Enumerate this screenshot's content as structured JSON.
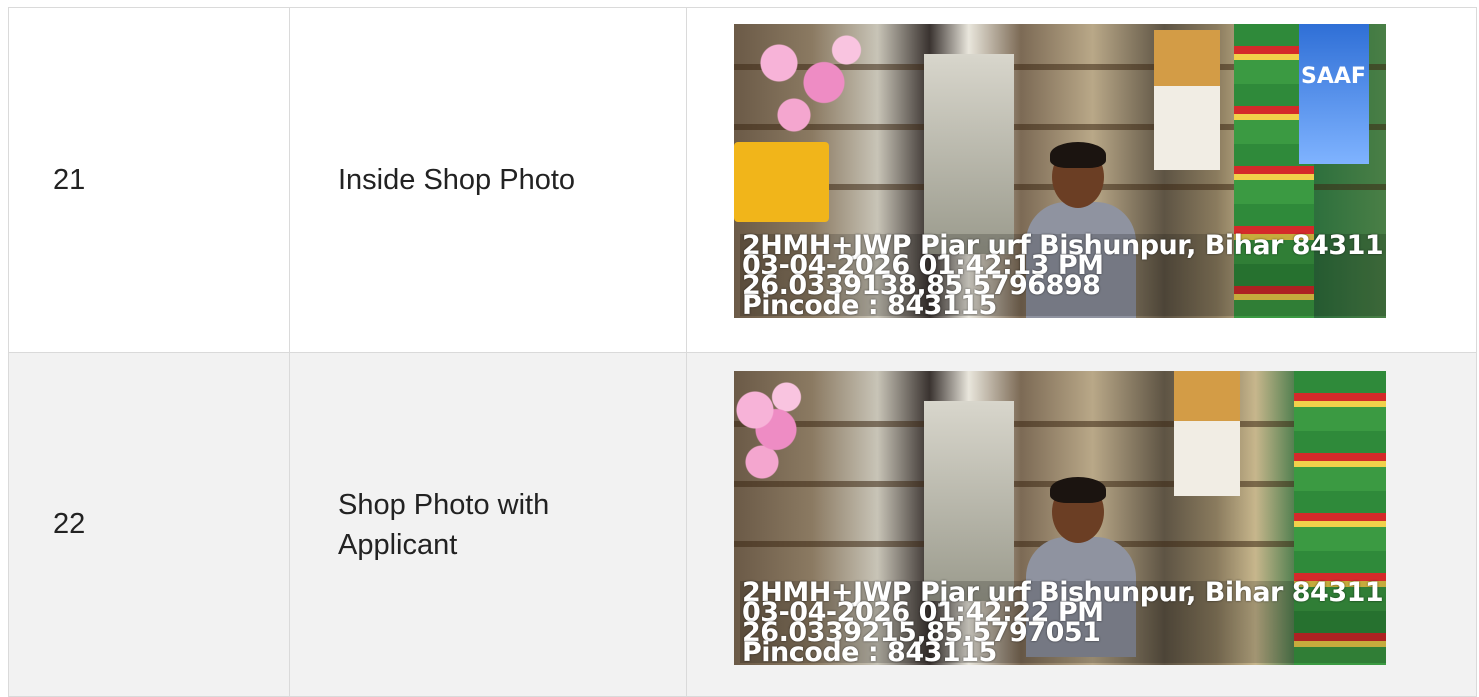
{
  "rows": [
    {
      "number": "21",
      "label": "Inside Shop Photo",
      "photo": {
        "address": "2HMH+JWP Pjar urf Bishunpur, Bihar 84311",
        "datetime": "03-04-2026 01:42:13 PM",
        "coordinates": "26.0339138,85.5796898",
        "pincode": "Pincode : 843115",
        "sign_text": "SAAF"
      }
    },
    {
      "number": "22",
      "label_line1": "Shop Photo with",
      "label_line2": "Applicant",
      "photo": {
        "address": "2HMH+JWP Pjar urf Bishunpur, Bihar 84311",
        "datetime": "03-04-2026 01:42:22 PM",
        "coordinates": "26.0339215,85.5797051",
        "pincode": "Pincode : 843115"
      }
    }
  ]
}
